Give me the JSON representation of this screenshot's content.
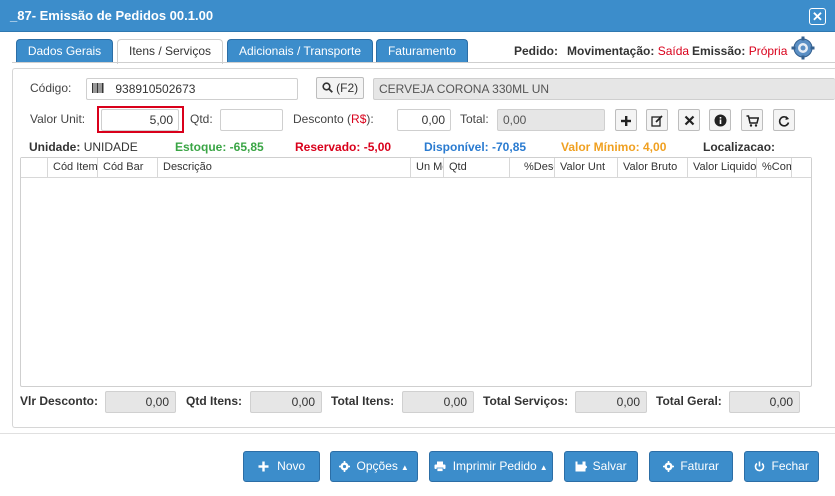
{
  "window": {
    "title": "_87- Emissão de Pedidos 00.1.00",
    "close_glyph": "✕"
  },
  "tabs": [
    {
      "label": "Dados Gerais",
      "active": false
    },
    {
      "label": "Itens / Serviços",
      "active": true
    },
    {
      "label": "Adicionais / Transporte",
      "active": false
    },
    {
      "label": "Faturamento",
      "active": false
    }
  ],
  "header": {
    "pedido_label": "Pedido:",
    "movimentacao_label": "Movimentação:",
    "movimentacao_value": "Saída",
    "emissao_label": "Emissão:",
    "emissao_value": "Própria"
  },
  "form": {
    "codigo_label": "Código:",
    "codigo_value": "938910502673",
    "search_label": "(F2)",
    "descricao_value": "CERVEJA CORONA 330ML UN",
    "valor_unit_label": "Valor Unit:",
    "valor_unit_value": "5,00",
    "qtd_label": "Qtd:",
    "qtd_value": "",
    "desconto_label_pre": "Desconto (",
    "desconto_label_currency": "R$",
    "desconto_label_post": "):",
    "desconto_value": "0,00",
    "total_label": "Total:",
    "total_value": "0,00"
  },
  "info": {
    "unidade_label": "Unidade:",
    "unidade_value": "UNIDADE",
    "estoque": "Estoque: -65,85",
    "reservado": "Reservado: -5,00",
    "disponivel": "Disponível: -70,85",
    "valor_minimo": "Valor Mínimo: 4,00",
    "localizacao": "Localizacao:"
  },
  "grid": {
    "columns": [
      "Cód Item",
      "Cód Bar",
      "Descrição",
      "Un Med",
      "Qtd",
      "%Desc",
      "Valor Unt",
      "Valor Bruto",
      "Valor Liquido",
      "%Com"
    ]
  },
  "totals": {
    "vlr_desconto_label": "Vlr Desconto:",
    "vlr_desconto_value": "0,00",
    "qtd_itens_label": "Qtd Itens:",
    "qtd_itens_value": "0,00",
    "total_itens_label": "Total Itens:",
    "total_itens_value": "0,00",
    "total_servicos_label": "Total Serviços:",
    "total_servicos_value": "0,00",
    "total_geral_label": "Total Geral:",
    "total_geral_value": "0,00"
  },
  "buttons": {
    "novo": "Novo",
    "opcoes": "Opções",
    "imprimir": "Imprimir Pedido",
    "salvar": "Salvar",
    "faturar": "Faturar",
    "fechar": "Fechar"
  },
  "colors": {
    "primary": "#3c8dcb",
    "estoque": "#3aa545",
    "reservado": "#d9001b",
    "disponivel": "#2a7bd0",
    "valor_minimo": "#f0a020",
    "highlight_border": "#d9001b"
  },
  "icons": {
    "barcode": "barcode-icon",
    "search": "search-icon",
    "add": "plus-icon",
    "edit": "edit-icon",
    "remove": "close-icon",
    "info": "info-icon",
    "cart": "cart-icon",
    "refresh": "refresh-icon",
    "settings": "gear-icon"
  }
}
